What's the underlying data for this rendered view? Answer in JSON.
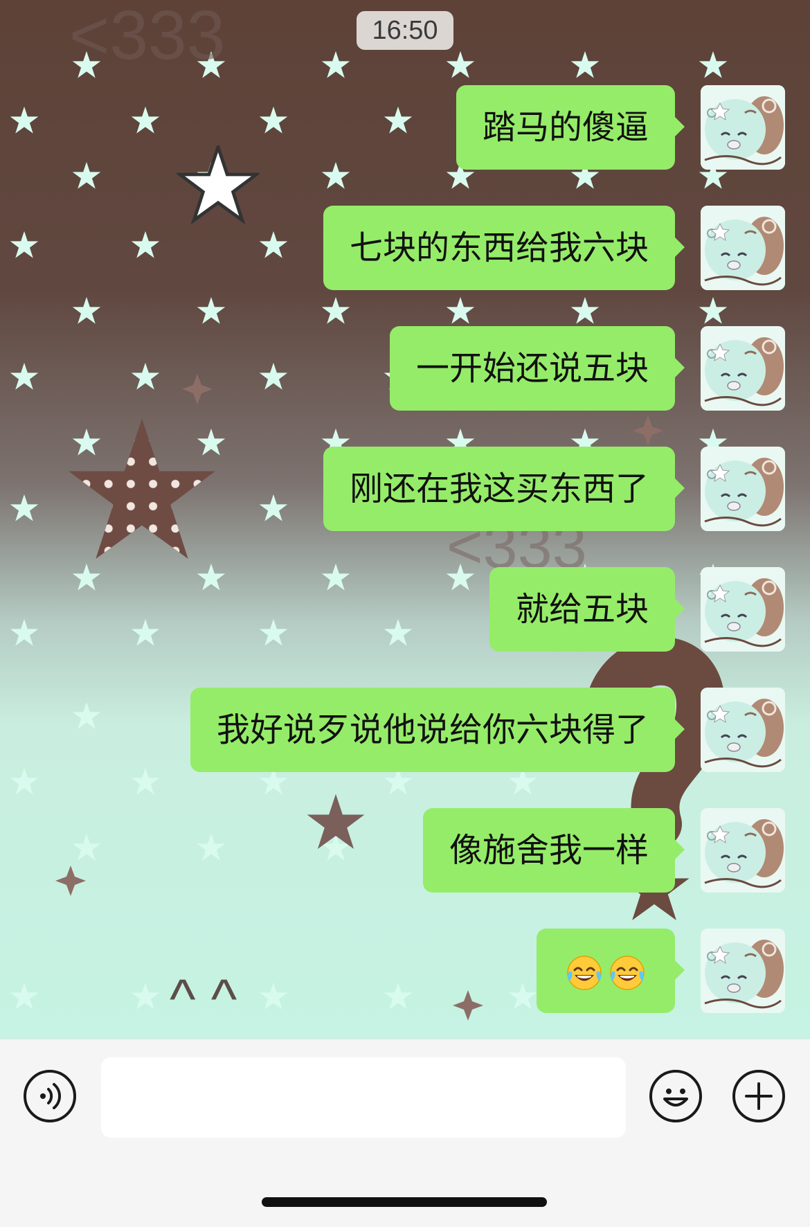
{
  "status": {
    "time": "16:50"
  },
  "messages": [
    {
      "text": "踏马的傻逼",
      "sender": "me"
    },
    {
      "text": "七块的东西给我六块",
      "sender": "me"
    },
    {
      "text": "一开始还说五块",
      "sender": "me"
    },
    {
      "text": "刚还在我这买东西了",
      "sender": "me"
    },
    {
      "text": "就给五块",
      "sender": "me"
    },
    {
      "text": "我好说歹说他说给你六块得了",
      "sender": "me"
    },
    {
      "text": "像施舍我一样",
      "sender": "me"
    },
    {
      "text": "",
      "sender": "me",
      "emoji": [
        "tears-of-joy-emoji",
        "tears-of-joy-emoji"
      ]
    }
  ],
  "input": {
    "placeholder": "",
    "value": ""
  },
  "icons": {
    "voice": "voice-icon",
    "emoji": "emoji-face-icon",
    "plus": "plus-icon"
  },
  "colors": {
    "bubble": "#95ec69",
    "background_top": "#5e4238",
    "background_bottom": "#c6f3e3",
    "input_bar": "#f5f5f5"
  }
}
